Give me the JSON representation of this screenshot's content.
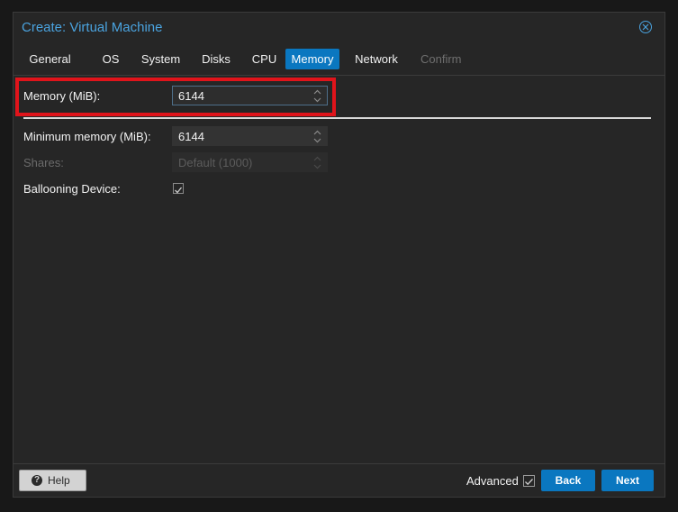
{
  "dialog": {
    "title": "Create: Virtual Machine"
  },
  "tabs": [
    {
      "label": "General",
      "state": "normal"
    },
    {
      "label": "OS",
      "state": "normal"
    },
    {
      "label": "System",
      "state": "normal"
    },
    {
      "label": "Disks",
      "state": "normal"
    },
    {
      "label": "CPU",
      "state": "normal"
    },
    {
      "label": "Memory",
      "state": "active"
    },
    {
      "label": "Network",
      "state": "normal"
    },
    {
      "label": "Confirm",
      "state": "disabled"
    }
  ],
  "form": {
    "memory": {
      "label": "Memory (MiB):",
      "value": "6144"
    },
    "min_memory": {
      "label": "Minimum memory (MiB):",
      "value": "6144"
    },
    "shares": {
      "label": "Shares:",
      "placeholder": "Default (1000)"
    },
    "ballooning": {
      "label": "Ballooning Device:",
      "checked": true
    }
  },
  "footer": {
    "help_label": "Help",
    "advanced_label": "Advanced",
    "advanced_checked": true,
    "back_label": "Back",
    "next_label": "Next"
  },
  "colors": {
    "accent": "#0a77c0",
    "title": "#4aa3df",
    "highlight": "#e0141b"
  },
  "icons": {
    "close": "close-circle-icon",
    "help": "question-circle-icon",
    "spinner": "up-down-chevron-icon",
    "check": "checkmark-icon"
  }
}
